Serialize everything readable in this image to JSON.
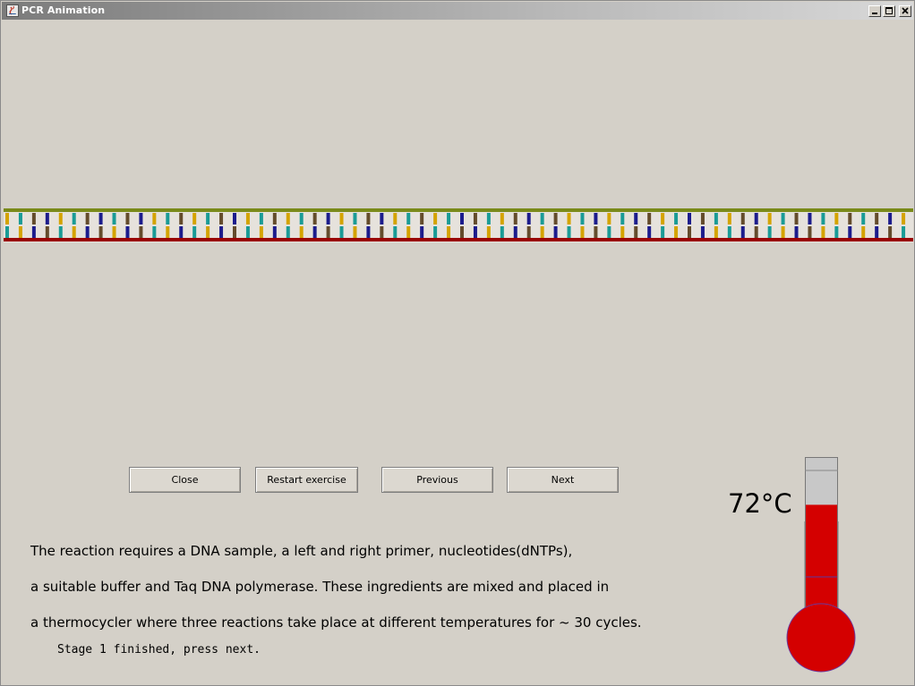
{
  "window": {
    "title": "PCR Animation",
    "controls": {
      "minimize": "minimize-icon",
      "maximize": "maximize-icon",
      "close": "close-icon"
    }
  },
  "dna": {
    "colors": {
      "top_strand": "#7a8a1a",
      "bottom_strand": "#990000",
      "background": "#e6e2dc",
      "A": "#d4a300",
      "T": "#1a9b96",
      "G": "#644c2c",
      "C": "#1c1c8c"
    },
    "top_sequence": "ATGCATGCTGCATGATGCATGATGCATGCATGATCGTAGCTGATCATCGATCGTAGCATGCTAGTGCA",
    "bottom_sequence": "TACGTACGACGTACTACGTACTACGTACGTACTAGCATCGACTAGTAGCTAGCATCGTACGATCACGT"
  },
  "buttons": {
    "close": "Close",
    "restart": "Restart exercise",
    "previous": "Previous",
    "next": "Next"
  },
  "description": {
    "line1": " The reaction requires a DNA sample, a left and right primer, nucleotides(dNTPs),",
    "line2": "a suitable buffer and Taq DNA polymerase. These ingredients are mixed and placed in",
    "line3": "a thermocycler where three reactions take place at different temperatures for ~ 30 cycles."
  },
  "status": "Stage 1 finished, press next.",
  "thermometer": {
    "label": "72°C",
    "value_celsius": 72,
    "fill_fraction": 0.77,
    "colors": {
      "fill": "#d40000",
      "empty": "#c8c8c8"
    }
  }
}
